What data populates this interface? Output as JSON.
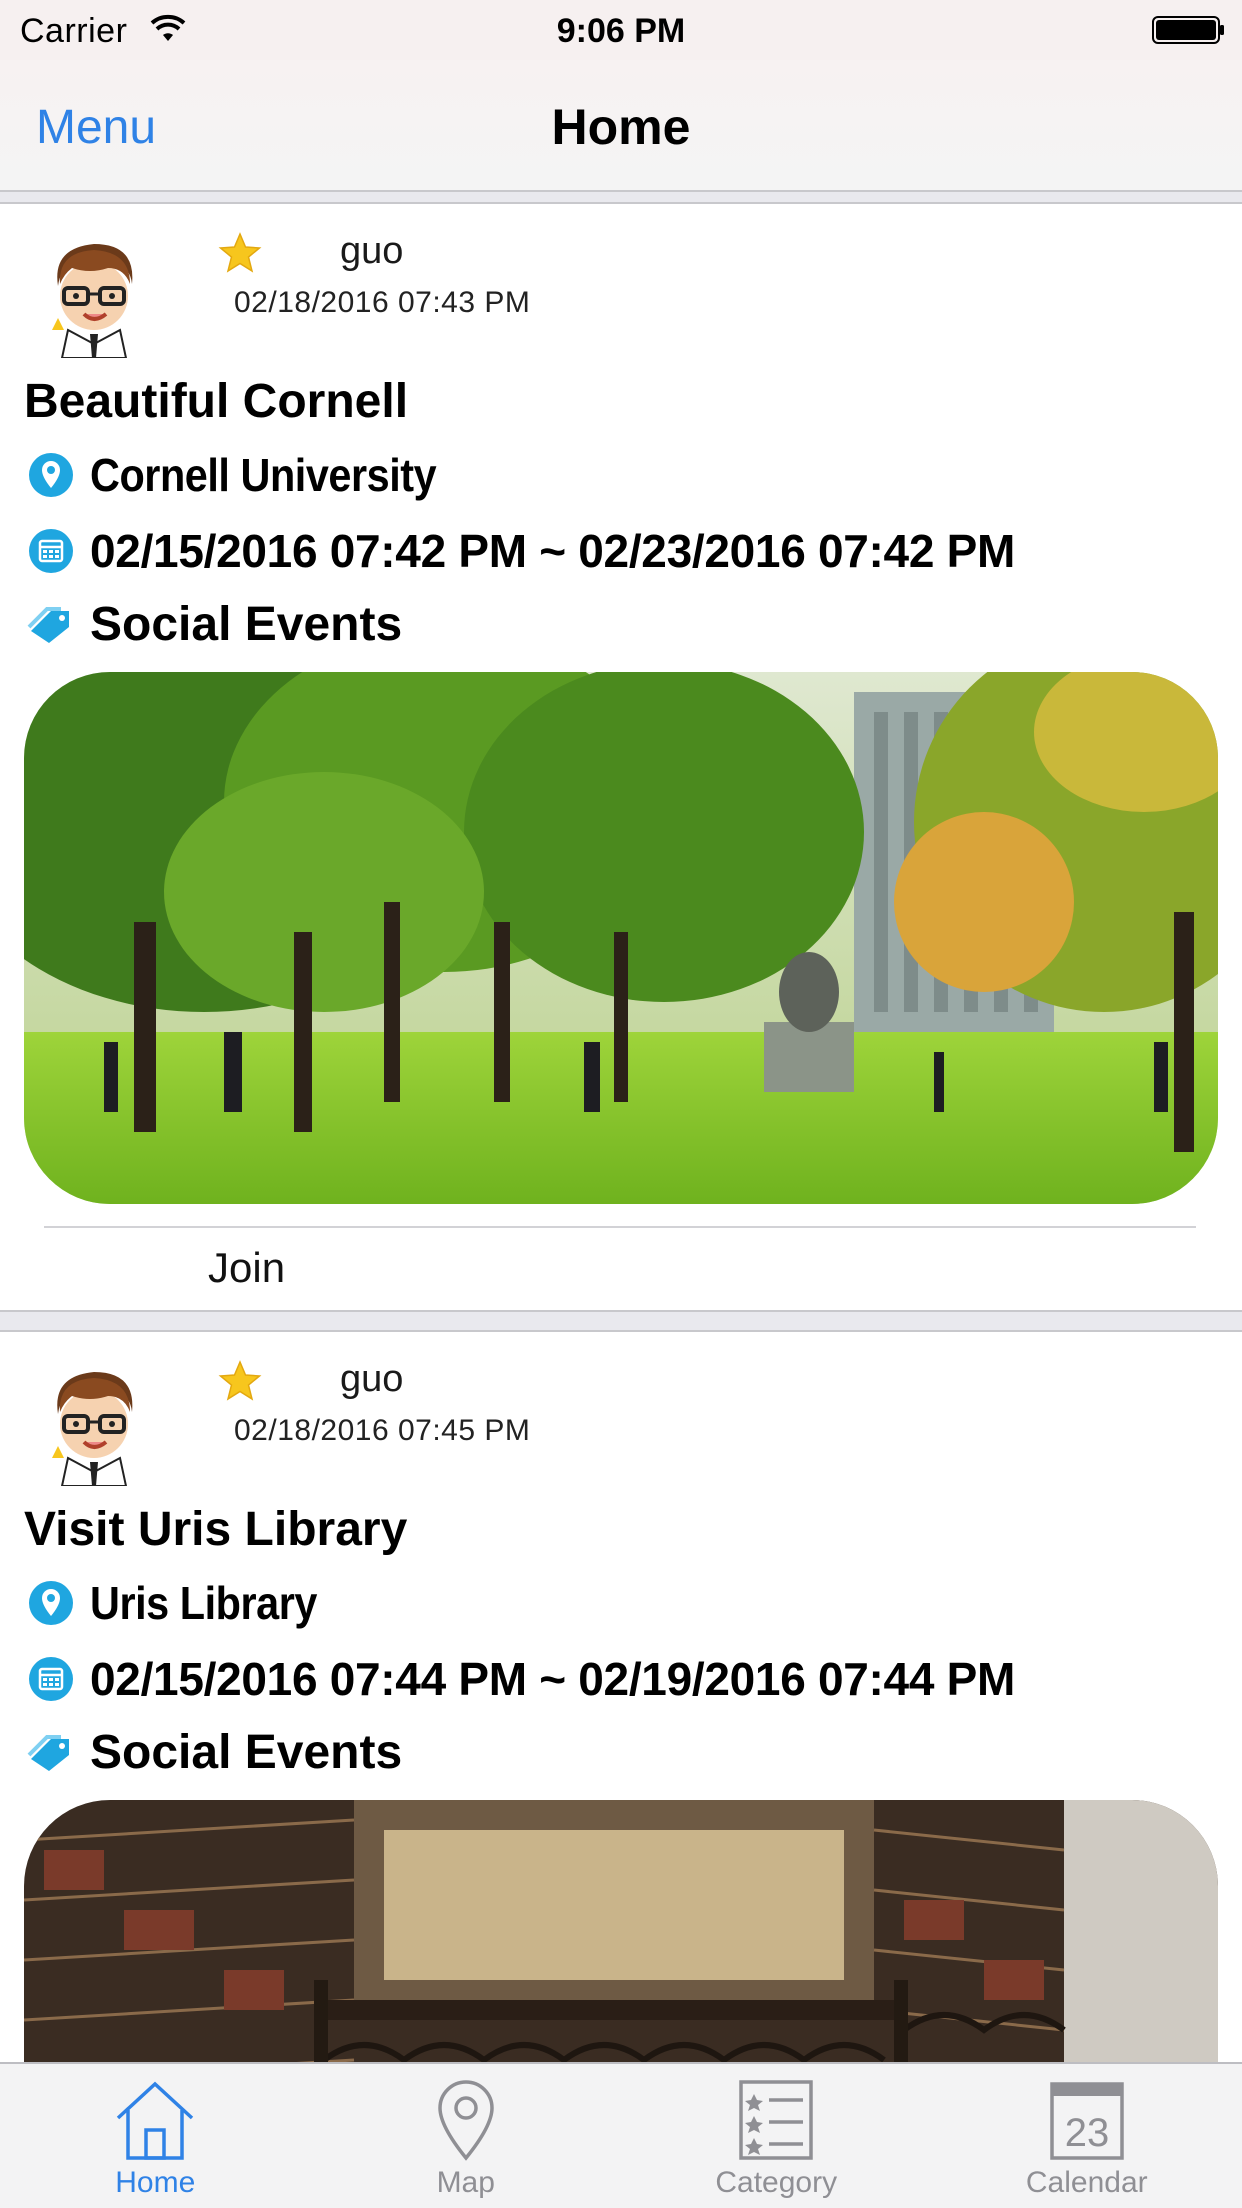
{
  "status_bar": {
    "carrier": "Carrier",
    "time": "9:06 PM"
  },
  "nav": {
    "menu_label": "Menu",
    "title": "Home"
  },
  "posts": [
    {
      "author": "guo",
      "posted_at": "02/18/2016 07:43 PM",
      "title": "Beautiful Cornell",
      "location": "Cornell University",
      "time_range": "02/15/2016 07:42 PM ~ 02/23/2016 07:42 PM",
      "category": "Social Events",
      "photo": "campus-quad-photo",
      "join_label": "Join"
    },
    {
      "author": "guo",
      "posted_at": "02/18/2016 07:45 PM",
      "title": "Visit Uris Library",
      "location": "Uris Library",
      "time_range": "02/15/2016 07:44 PM ~ 02/19/2016 07:44 PM",
      "category": "Social Events",
      "photo": "library-stacks-photo"
    }
  ],
  "tabs": [
    {
      "label": "Home",
      "icon": "home-icon",
      "active": true
    },
    {
      "label": "Map",
      "icon": "map-pin-icon",
      "active": false
    },
    {
      "label": "Category",
      "icon": "list-icon",
      "active": false
    },
    {
      "label": "Calendar",
      "icon": "calendar-icon",
      "active": false,
      "icon_text": "23"
    }
  ],
  "colors": {
    "accent": "#2f82e6",
    "icon_blue": "#1fa6e0",
    "tab_inactive": "#8f8f94",
    "star": "#f7c61d"
  }
}
